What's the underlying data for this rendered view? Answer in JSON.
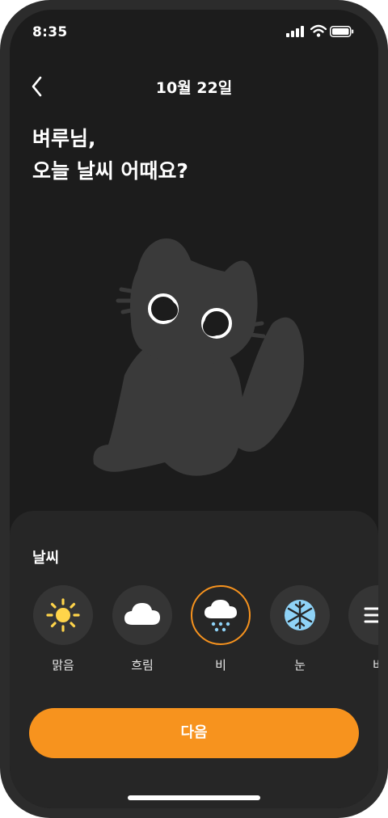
{
  "status_bar": {
    "time": "8:35",
    "icons": [
      "cellular-signal-icon",
      "wifi-icon",
      "battery-icon"
    ]
  },
  "header": {
    "back_icon": "chevron-left-icon",
    "title": "10월 22일"
  },
  "greeting": {
    "line1": "벼루님,",
    "line2": "오늘 날씨 어때요?"
  },
  "illustration": "black-cat-illustration",
  "weather_section": {
    "label": "날씨",
    "options": [
      {
        "label": "맑음",
        "icon": "sun-icon",
        "selected": false
      },
      {
        "label": "흐림",
        "icon": "cloud-icon",
        "selected": false
      },
      {
        "label": "비",
        "icon": "rain-cloud-icon",
        "selected": true
      },
      {
        "label": "눈",
        "icon": "snowflake-icon",
        "selected": false
      },
      {
        "label": "바",
        "icon": "wind-icon",
        "selected": false
      }
    ]
  },
  "next_button": {
    "label": "다음"
  },
  "colors": {
    "background": "#1c1c1c",
    "sheet": "#262626",
    "accent": "#f7931e",
    "option_bg": "#353535",
    "cat": "#3a3a3a",
    "sun": "#ffd44a",
    "snow": "#8fd3f7",
    "rain": "#8fd3f7"
  }
}
